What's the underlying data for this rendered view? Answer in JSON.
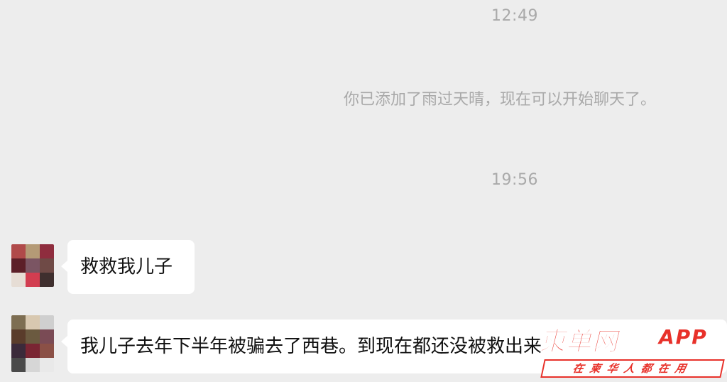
{
  "chat": {
    "timestamps": [
      "12:49",
      "19:56"
    ],
    "system_message": "你已添加了雨过天晴，现在可以开始聊天了。",
    "messages": [
      {
        "text": "救救我儿子"
      },
      {
        "text": "我儿子去年下半年被骗去了西巷。到现在都还没被救出来"
      }
    ]
  },
  "avatar_colors": {
    "first": [
      "#b04a4a",
      "#b49a76",
      "#8f2d3e",
      "#5c1f28",
      "#7b5563",
      "#6f4a46",
      "#e6ddd5",
      "#d23d50",
      "#3f2f2e"
    ],
    "second": [
      "#7d6e52",
      "#d8c8b0",
      "#cfcfcf",
      "#5a3c2b",
      "#6b5a40",
      "#7a4b55",
      "#3b2a3a",
      "#7a2533",
      "#8b5046",
      "#4a4a4a",
      "#d6d6d6",
      "#e9e9e9"
    ]
  },
  "watermark": {
    "brand": "柬单网",
    "app": "APP",
    "slogan": "在柬华人都在用",
    "color": "#e8312a"
  },
  "colors": {
    "background": "#ededed",
    "bubble": "#ffffff",
    "meta_text": "#a9a9a9"
  }
}
